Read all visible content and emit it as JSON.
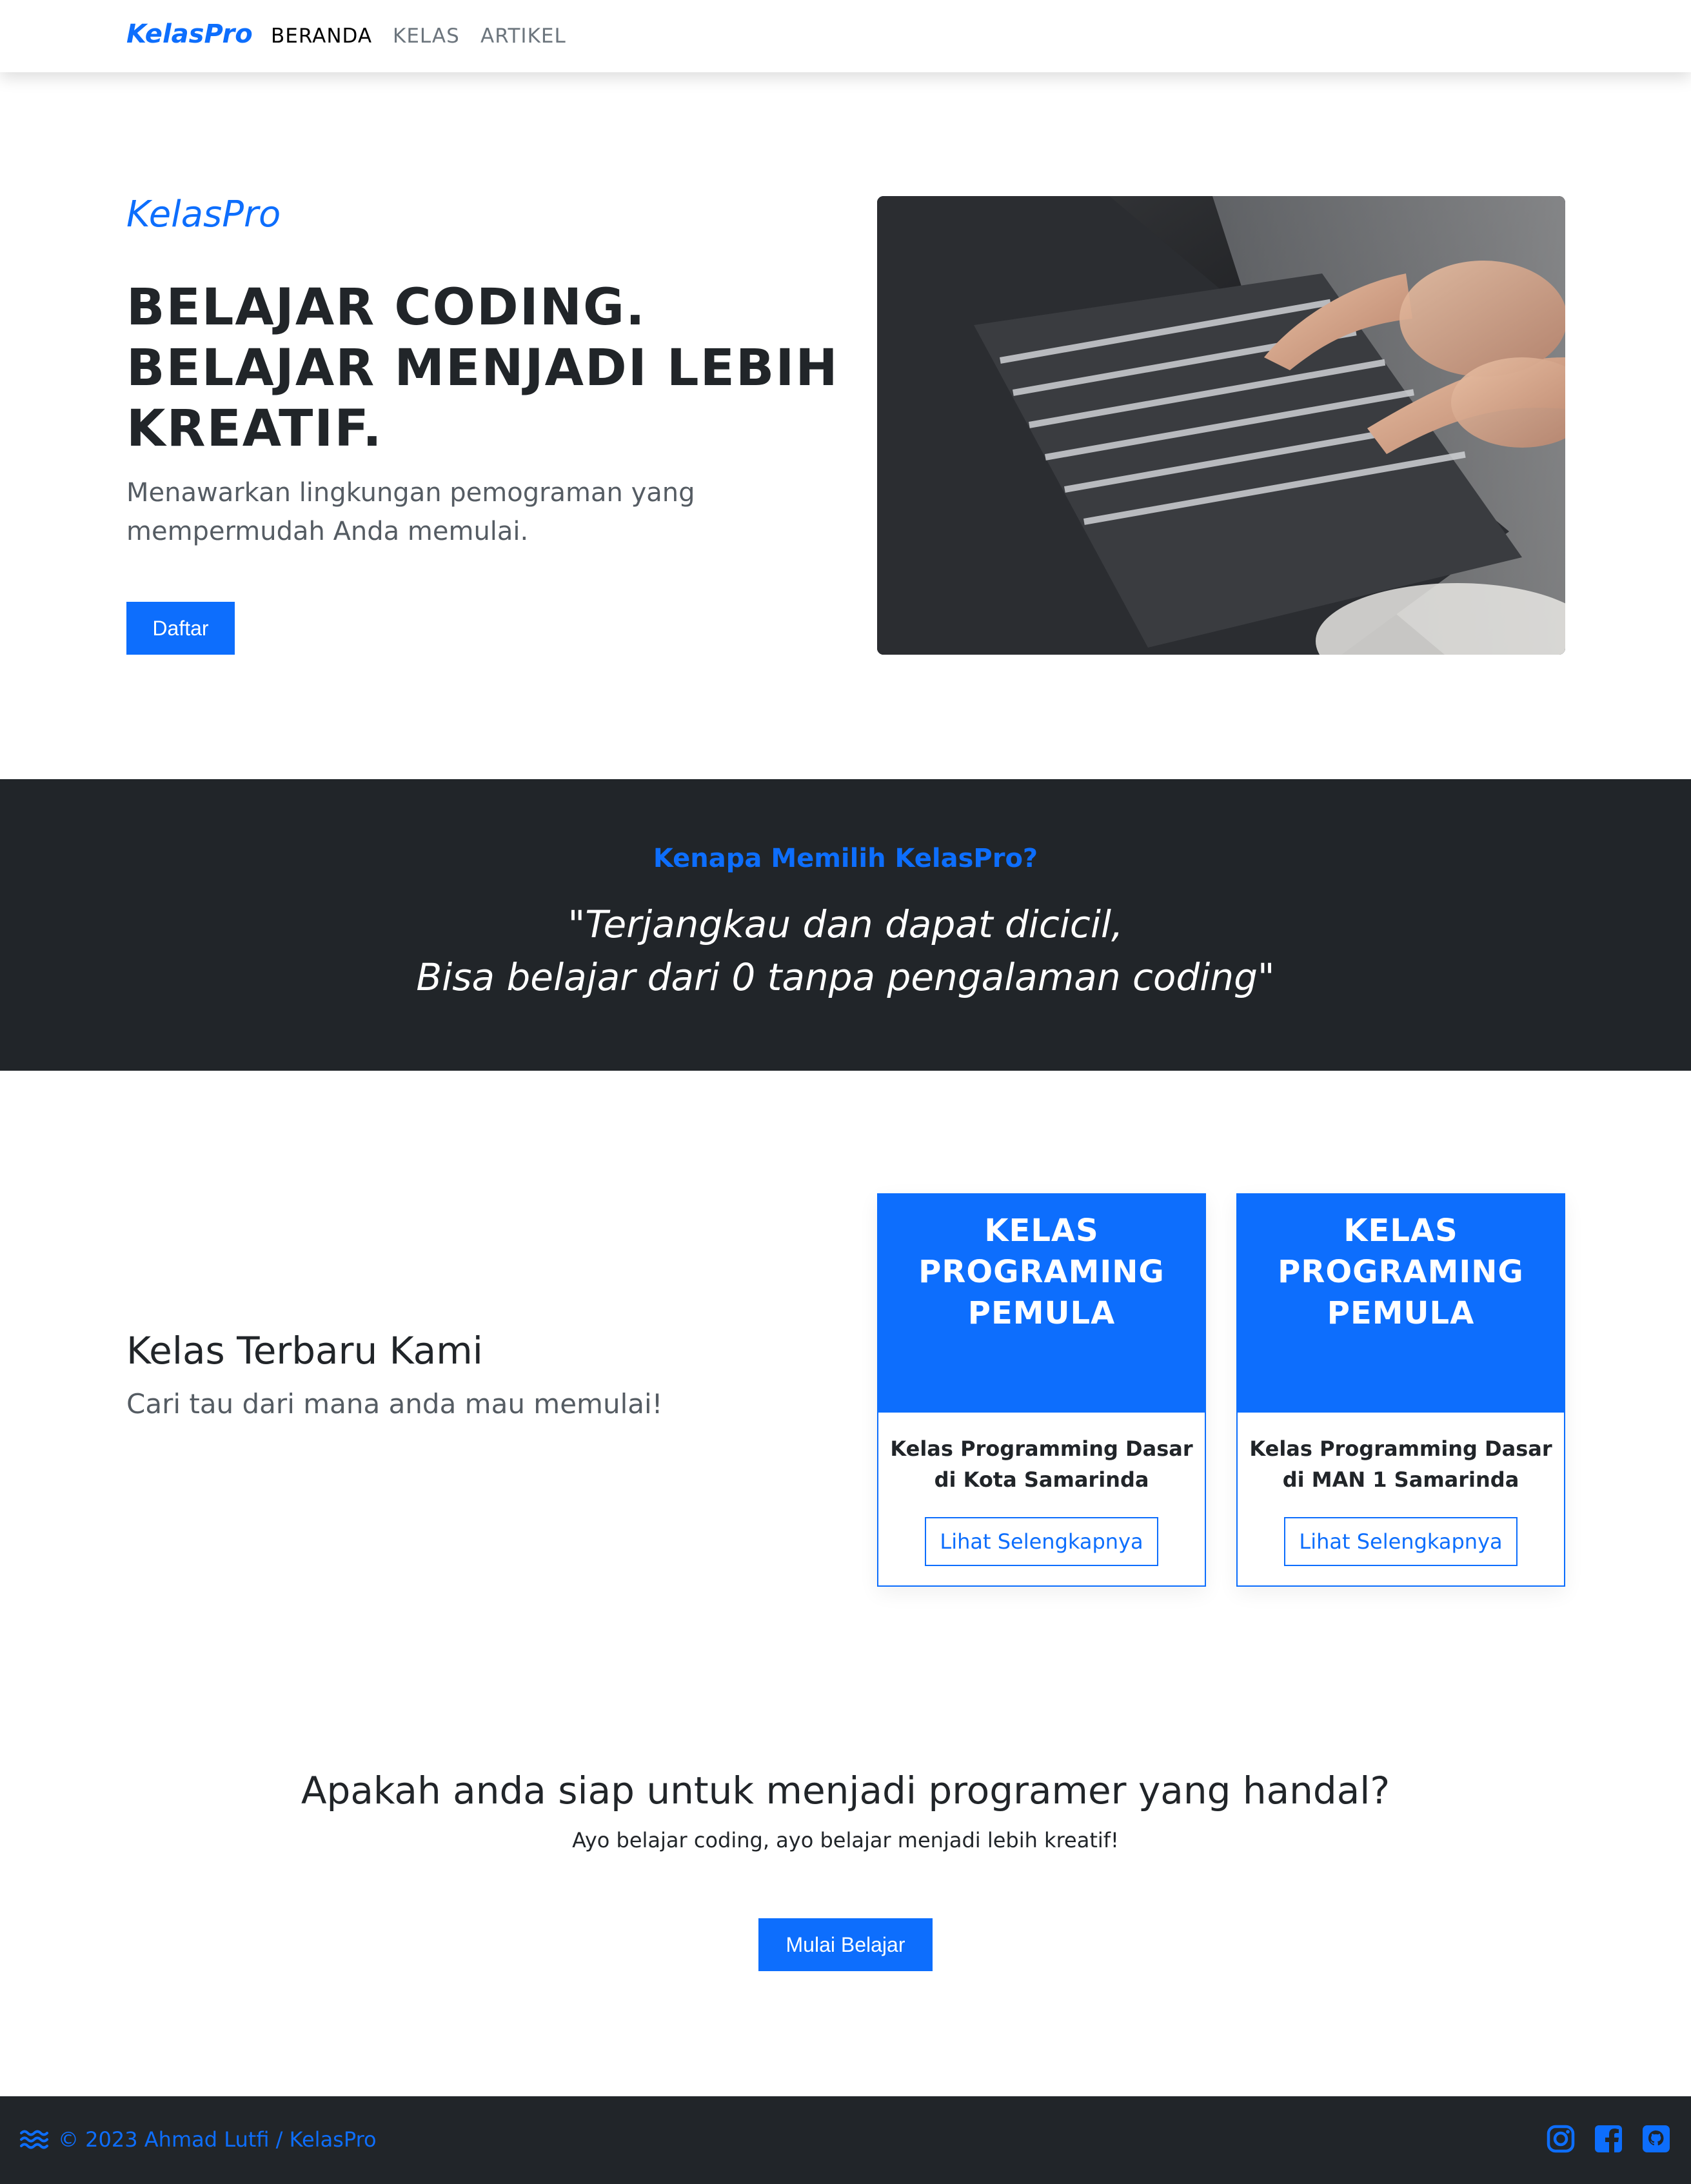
{
  "nav": {
    "brand": "KelasPro",
    "links": [
      "BERANDA",
      "KELAS",
      "ARTIKEL"
    ],
    "active": "BERANDA"
  },
  "hero": {
    "brand": "KelasPro",
    "title_lines": [
      "BELAJAR CODING.",
      "BELAJAR MENJADI LEBIH",
      "KREATIF."
    ],
    "subtitle": "Menawarkan lingkungan pemograman yang mempermudah Anda memulai.",
    "button": "Daftar",
    "image": "laptop-typing-photo"
  },
  "why": {
    "heading": "Kenapa Memilih KelasPro?",
    "quote_lines": [
      "\"Terjangkau dan dapat dicicil,",
      "Bisa belajar dari 0 tanpa pengalaman coding\""
    ]
  },
  "classes": {
    "title": "Kelas Terbaru Kami",
    "subtitle": "Cari tau dari mana anda mau memulai!",
    "cards": [
      {
        "head_lines": [
          "KELAS",
          "PROGRAMING",
          "PEMULA"
        ],
        "desc_lines": [
          "Kelas Programming Dasar",
          "di Kota Samarinda"
        ],
        "button": "Lihat Selengkapnya"
      },
      {
        "head_lines": [
          "KELAS",
          "PROGRAMING",
          "PEMULA"
        ],
        "desc_lines": [
          "Kelas Programming Dasar",
          "di MAN 1 Samarinda"
        ],
        "button": "Lihat Selengkapnya"
      }
    ]
  },
  "cta": {
    "title": "Apakah anda siap untuk menjadi programer yang handal?",
    "subtitle": "Ayo belajar coding, ayo belajar menjadi lebih kreatif!",
    "button": "Mulai Belajar"
  },
  "footer": {
    "copyright": "© 2023 Ahmad Lutfi / KelasPro",
    "icons": [
      "waves-icon",
      "instagram-icon",
      "facebook-icon",
      "github-icon"
    ]
  },
  "colors": {
    "primary": "#0d6efd",
    "dark": "#212529",
    "muted": "#6c757d"
  }
}
